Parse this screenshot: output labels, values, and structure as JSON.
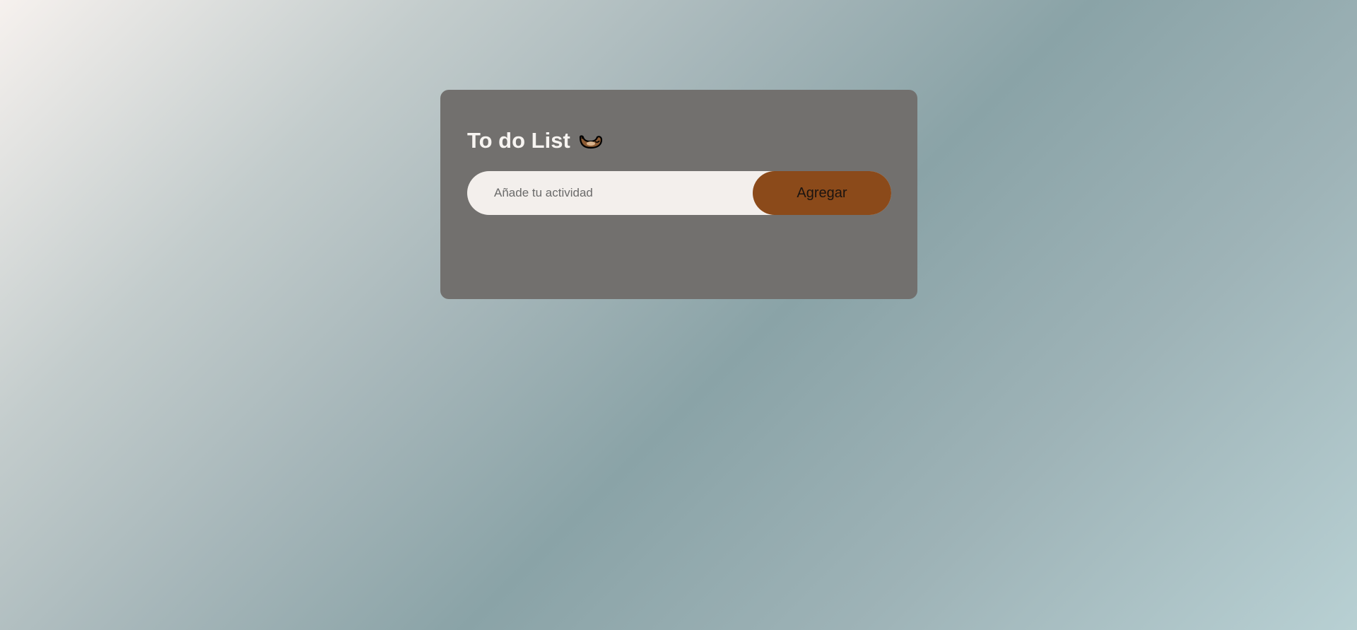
{
  "app": {
    "title": "To do List",
    "title_icon": "otter-icon"
  },
  "form": {
    "input_value": "",
    "input_placeholder": "Añade tu actividad",
    "add_button_label": "Agregar"
  },
  "tasks": [],
  "colors": {
    "card_background": "#72706e",
    "input_background": "#f3efec",
    "button_background": "#8b4a1a",
    "title_text": "#f7f4f1"
  }
}
